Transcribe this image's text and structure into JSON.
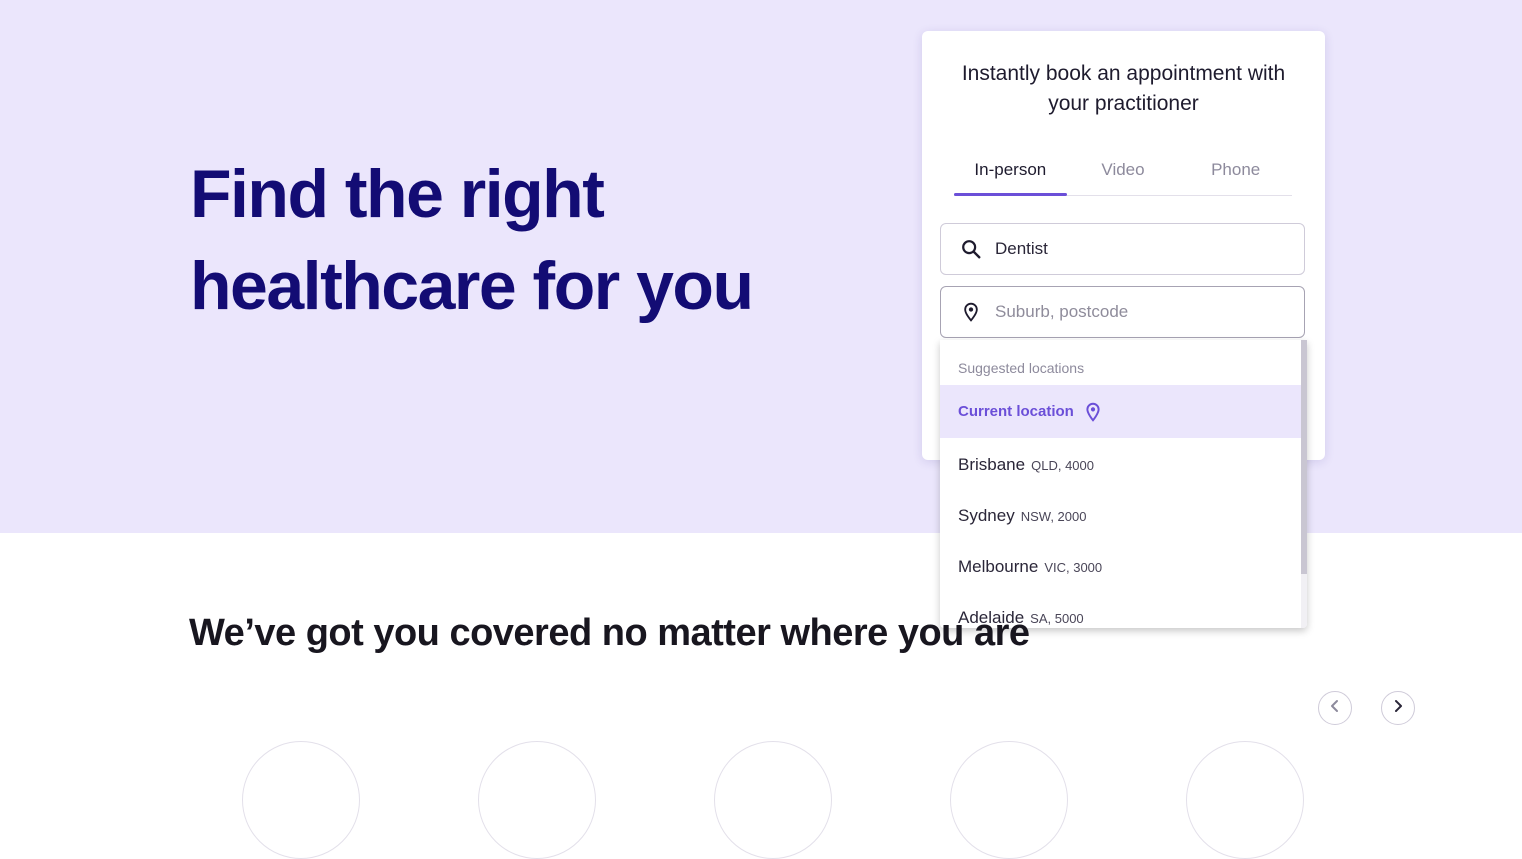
{
  "hero": {
    "title_line1": "Find the right",
    "title_line2": "healthcare for you"
  },
  "booking": {
    "title": "Instantly book an appointment with your practitioner",
    "tabs": [
      {
        "label": "In-person",
        "active": true
      },
      {
        "label": "Video",
        "active": false
      },
      {
        "label": "Phone",
        "active": false
      }
    ],
    "search": {
      "value": "Dentist",
      "icon": "search-icon"
    },
    "location": {
      "value": "",
      "placeholder": "Suburb, postcode",
      "icon": "location-pin-icon"
    }
  },
  "dropdown": {
    "header": "Suggested locations",
    "current_location": "Current location",
    "items": [
      {
        "city": "Brisbane",
        "sub": "QLD, 4000"
      },
      {
        "city": "Sydney",
        "sub": "NSW, 2000"
      },
      {
        "city": "Melbourne",
        "sub": "VIC, 3000"
      },
      {
        "city": "Adelaide",
        "sub": "SA, 5000"
      }
    ]
  },
  "section": {
    "title": "We’ve got you covered no matter where you are"
  },
  "carousel": {
    "prev_icon": "chevron-left-icon",
    "next_icon": "chevron-right-icon"
  },
  "colors": {
    "hero_bg": "#ebe6fc",
    "hero_title": "#130c74",
    "accent": "#6b4fd8"
  }
}
